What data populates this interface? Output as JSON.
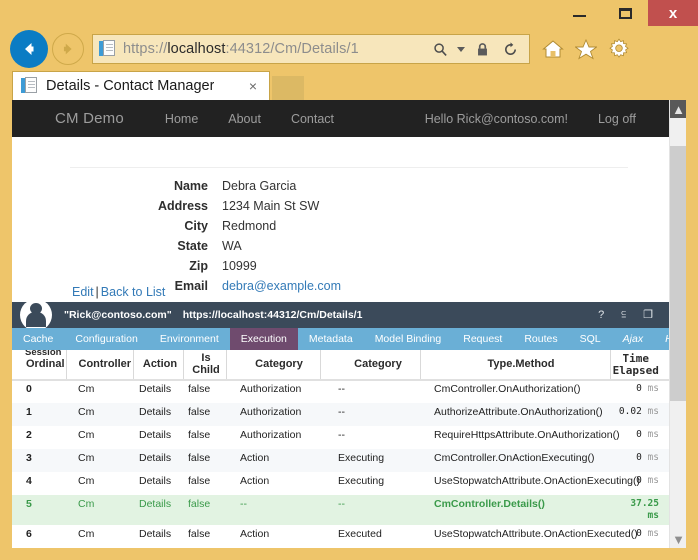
{
  "window": {
    "minimize_label": "Minimize",
    "maximize_label": "Maximize",
    "close_label": "x"
  },
  "browser": {
    "back_label": "Back",
    "forward_label": "Forward",
    "address": {
      "scheme": "https://",
      "host": "localhost",
      "rest": ":44312/Cm/Details/1",
      "full": "https://localhost:44312/Cm/Details/1"
    },
    "icons": {
      "search": "search-icon",
      "search_dropdown": "chevron-down-icon",
      "lock": "lock-icon",
      "refresh": "refresh-icon",
      "home": "home-icon",
      "favorites": "star-icon",
      "settings": "gear-icon"
    },
    "tab": {
      "title": "Details - Contact Manager",
      "close_label": "×"
    }
  },
  "site_nav": {
    "brand": "CM Demo",
    "links": [
      "Home",
      "About",
      "Contact"
    ],
    "greeting": "Hello Rick@contoso.com!",
    "logoff": "Log off"
  },
  "details": {
    "fields": [
      {
        "term": "Name",
        "value": "Debra Garcia",
        "is_link": false
      },
      {
        "term": "Address",
        "value": "1234 Main St SW",
        "is_link": false
      },
      {
        "term": "City",
        "value": "Redmond",
        "is_link": false
      },
      {
        "term": "State",
        "value": "WA",
        "is_link": false
      },
      {
        "term": "Zip",
        "value": "10999",
        "is_link": false
      },
      {
        "term": "Email",
        "value": "debra@example.com",
        "is_link": true
      }
    ],
    "edit_link": "Edit",
    "separator": "|",
    "back_link": "Back to List"
  },
  "glimpse": {
    "logo_name": "glimpse-logo",
    "user": "\"Rick@contoso.com\"",
    "url": "https://localhost:44312/Cm/Details/1",
    "actions": {
      "help": "?",
      "minimize": "⫅",
      "popout": "❐"
    },
    "tabs": [
      {
        "label": "Cache",
        "active": false,
        "italic": false
      },
      {
        "label": "Configuration",
        "active": false,
        "italic": false
      },
      {
        "label": "Environment",
        "active": false,
        "italic": false
      },
      {
        "label": "Execution",
        "active": true,
        "italic": false
      },
      {
        "label": "Metadata",
        "active": false,
        "italic": false
      },
      {
        "label": "Model Binding",
        "active": false,
        "italic": false
      },
      {
        "label": "Request",
        "active": false,
        "italic": false
      },
      {
        "label": "Routes",
        "active": false,
        "italic": false
      },
      {
        "label": "SQL",
        "active": false,
        "italic": false
      },
      {
        "label": "Ajax",
        "active": false,
        "italic": true
      },
      {
        "label": "Histo",
        "active": false,
        "italic": true
      }
    ],
    "overlay_label": "Session",
    "table": {
      "columns": [
        "Ordinal",
        "Controller",
        "Action",
        "Is Child",
        "Category",
        "Category",
        "Type.Method",
        "Time Elapsed"
      ],
      "rows": [
        {
          "ordinal": "0",
          "controller": "Cm",
          "action": "Details",
          "is_child": "false",
          "category1": "Authorization",
          "category2": "--",
          "type_method": "CmController.OnAuthorization()",
          "time": "0",
          "unit": "ms",
          "highlight": false
        },
        {
          "ordinal": "1",
          "controller": "Cm",
          "action": "Details",
          "is_child": "false",
          "category1": "Authorization",
          "category2": "--",
          "type_method": "AuthorizeAttribute.OnAuthorization()",
          "time": "0.02",
          "unit": "ms",
          "highlight": false
        },
        {
          "ordinal": "2",
          "controller": "Cm",
          "action": "Details",
          "is_child": "false",
          "category1": "Authorization",
          "category2": "--",
          "type_method": "RequireHttpsAttribute.OnAuthorization()",
          "time": "0",
          "unit": "ms",
          "highlight": false
        },
        {
          "ordinal": "3",
          "controller": "Cm",
          "action": "Details",
          "is_child": "false",
          "category1": "Action",
          "category2": "Executing",
          "type_method": "CmController.OnActionExecuting()",
          "time": "0",
          "unit": "ms",
          "highlight": false
        },
        {
          "ordinal": "4",
          "controller": "Cm",
          "action": "Details",
          "is_child": "false",
          "category1": "Action",
          "category2": "Executing",
          "type_method": "UseStopwatchAttribute.OnActionExecuting()",
          "time": "0",
          "unit": "ms",
          "highlight": false
        },
        {
          "ordinal": "5",
          "controller": "Cm",
          "action": "Details",
          "is_child": "false",
          "category1": "--",
          "category2": "--",
          "type_method": "CmController.Details()",
          "time": "37.25",
          "unit": "ms",
          "highlight": true
        },
        {
          "ordinal": "6",
          "controller": "Cm",
          "action": "Details",
          "is_child": "false",
          "category1": "Action",
          "category2": "Executed",
          "type_method": "UseStopwatchAttribute.OnActionExecuted()",
          "time": "0",
          "unit": "ms",
          "highlight": false
        }
      ]
    }
  },
  "colors": {
    "chrome_frame": "#eec56a",
    "close_button": "#c1504e",
    "back_button": "#0b7cc4",
    "site_nav": "#222222",
    "glimpse_topbar": "#3b4a5a",
    "glimpse_tabs": "#6aafd6",
    "glimpse_active_tab": "#6f4b6e",
    "link": "#337ab7",
    "highlight_row": "#e2f3e2"
  }
}
